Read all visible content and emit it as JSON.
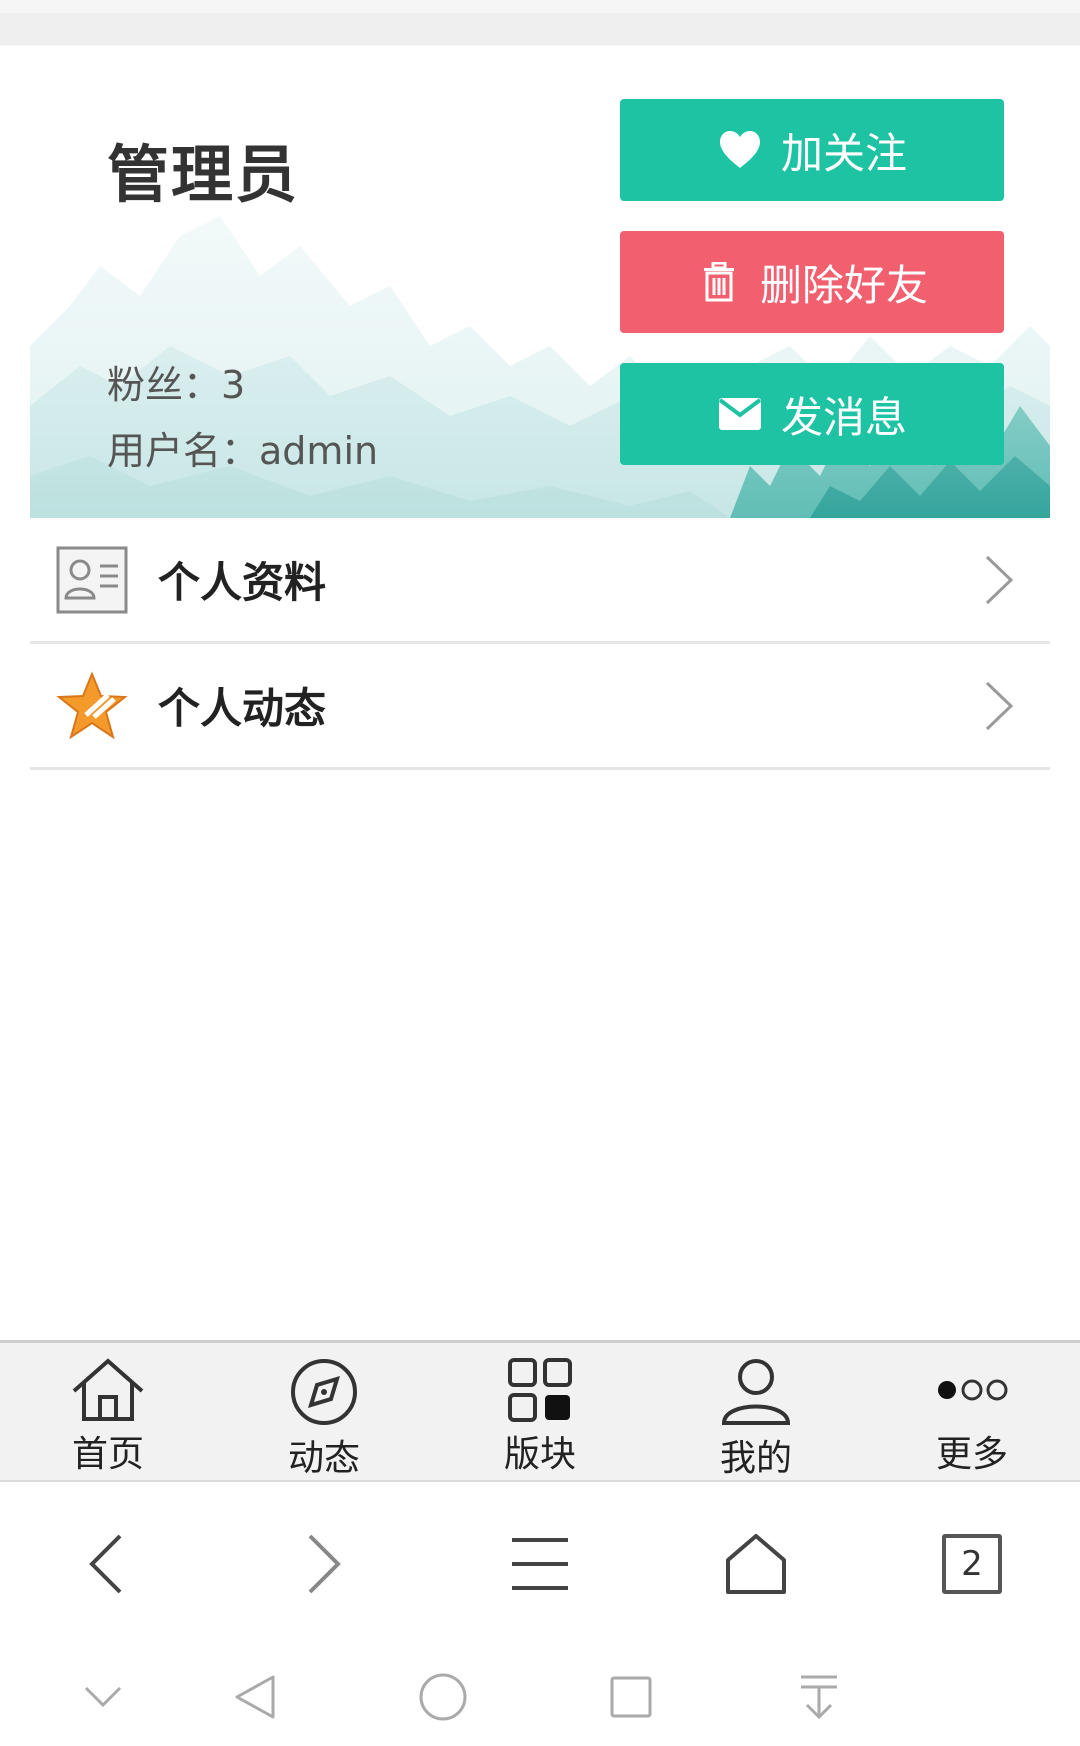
{
  "profile": {
    "name": "管理员",
    "fans_label": "粉丝：",
    "fans_value": "3",
    "username_label": "用户名：",
    "username_value": "admin"
  },
  "actions": {
    "follow": "加关注",
    "delete": "删除好友",
    "message": "发消息"
  },
  "menu": [
    {
      "label": "个人资料",
      "icon": "profile-card-icon"
    },
    {
      "label": "个人动态",
      "icon": "star-icon"
    }
  ],
  "tabbar": [
    {
      "label": "首页",
      "icon": "home-icon"
    },
    {
      "label": "动态",
      "icon": "compass-icon"
    },
    {
      "label": "版块",
      "icon": "grid-icon"
    },
    {
      "label": "我的",
      "icon": "user-icon"
    },
    {
      "label": "更多",
      "icon": "more-dots-icon"
    }
  ],
  "browser": {
    "tab_count": "2"
  },
  "colors": {
    "accent": "#1ec3a4",
    "danger": "#f25f6e"
  }
}
